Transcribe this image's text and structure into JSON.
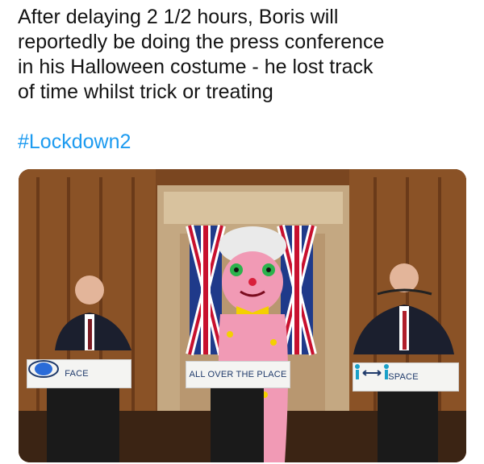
{
  "tweet": {
    "text": "After delaying 2 1/2 hours, Boris will\nreportedly be doing the press conference\nin his Halloween costume - he lost track\nof time whilst trick or treating",
    "hashtag": "#Lockdown2",
    "hashtag_color": "#1d9bf0"
  },
  "photo": {
    "signs": {
      "left": "FACE",
      "center": "ALL OVER THE PLACE",
      "right": "SPACE"
    },
    "icons": {
      "left": "face-mask-icon",
      "right": "social-distance-icon"
    }
  }
}
